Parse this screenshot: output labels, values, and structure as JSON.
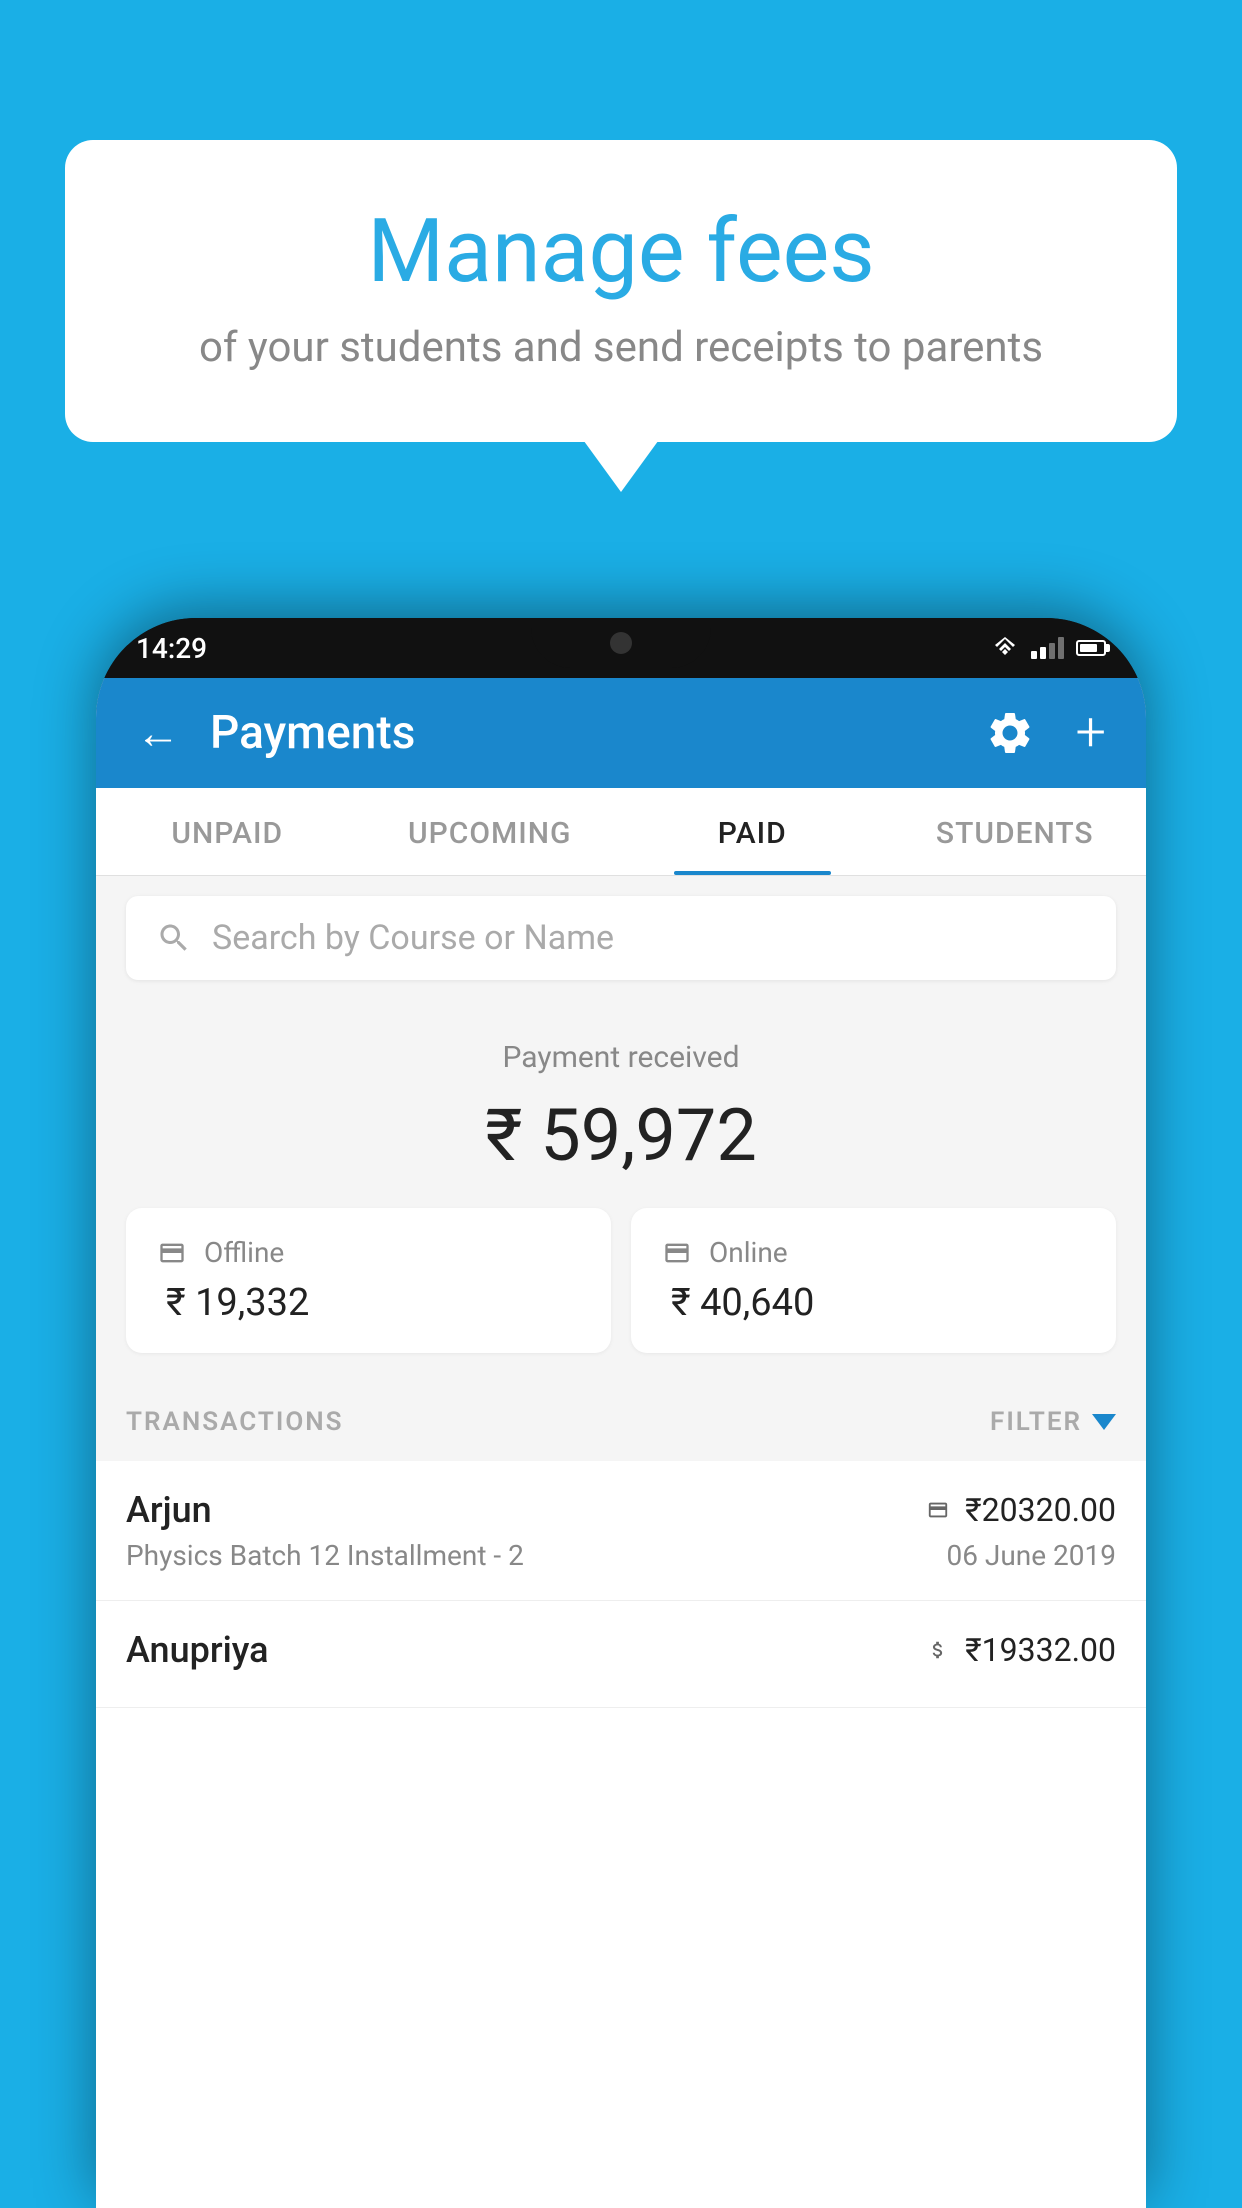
{
  "background_color": "#1aafe6",
  "speech_bubble": {
    "title": "Manage fees",
    "subtitle": "of your students and send receipts to parents"
  },
  "phone": {
    "status_bar": {
      "time": "14:29"
    },
    "app_header": {
      "title": "Payments",
      "back_label": "←",
      "plus_label": "+"
    },
    "tabs": [
      {
        "id": "unpaid",
        "label": "UNPAID",
        "active": false
      },
      {
        "id": "upcoming",
        "label": "UPCOMING",
        "active": false
      },
      {
        "id": "paid",
        "label": "PAID",
        "active": true
      },
      {
        "id": "students",
        "label": "STUDENTS",
        "active": false
      }
    ],
    "search": {
      "placeholder": "Search by Course or Name"
    },
    "payment_summary": {
      "label": "Payment received",
      "amount": "₹ 59,972",
      "offline": {
        "type": "Offline",
        "amount": "₹ 19,332"
      },
      "online": {
        "type": "Online",
        "amount": "₹ 40,640"
      }
    },
    "transactions_section": {
      "label": "TRANSACTIONS",
      "filter_label": "FILTER"
    },
    "transactions": [
      {
        "name": "Arjun",
        "course": "Physics Batch 12 Installment - 2",
        "amount": "₹20320.00",
        "date": "06 June 2019",
        "payment_type": "online"
      },
      {
        "name": "Anupriya",
        "course": "",
        "amount": "₹19332.00",
        "date": "",
        "payment_type": "offline"
      }
    ]
  }
}
